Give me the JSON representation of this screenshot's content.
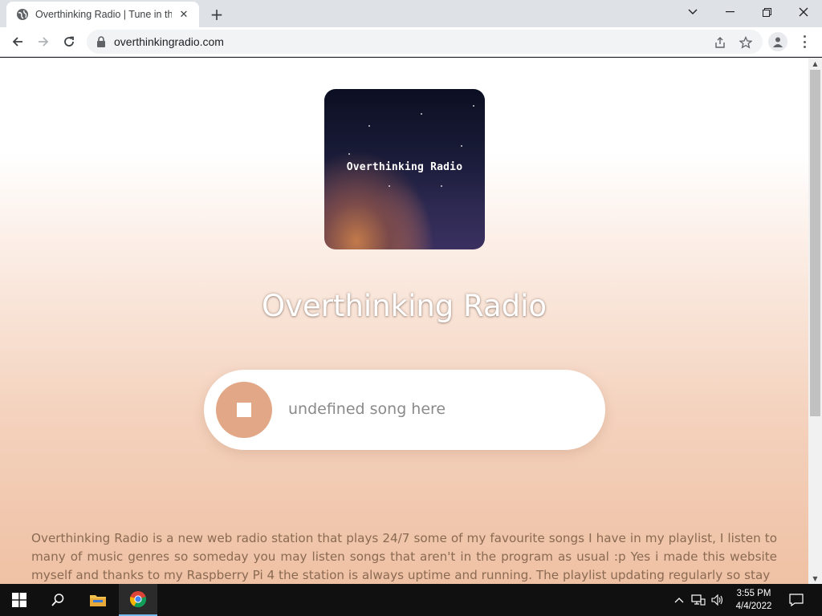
{
  "browser": {
    "tab_title": "Overthinking Radio | Tune in the",
    "url": "overthinkingradio.com",
    "new_tab_symbol": "+",
    "close_tab_symbol": "✕",
    "window_controls": {
      "dropdown": "⌄",
      "minimize": "—",
      "restore": "❐",
      "close": "✕"
    }
  },
  "page": {
    "cover_text": "Overthinking Radio",
    "site_title": "Overthinking Radio",
    "now_playing": "undefined song here",
    "player_state": "playing",
    "about_text": "Overthinking Radio is a new web radio station that plays 24/7 some of my favourite songs I have in my playlist, I listen to many of music genres so someday you may listen songs that aren't in the program as usual :p Yes i made this website myself and thanks to my Raspberry Pi 4 the station is always uptime and running. The playlist updating regularly so stay"
  },
  "taskbar": {
    "time": "3:55 PM",
    "date": "4/4/2022",
    "pinned": [
      "start-icon",
      "search-icon",
      "file-explorer-icon",
      "chrome-icon"
    ]
  },
  "colors": {
    "accent": "#e2a787",
    "about_text": "#8a6a52",
    "song_text": "#8a8a8a"
  }
}
